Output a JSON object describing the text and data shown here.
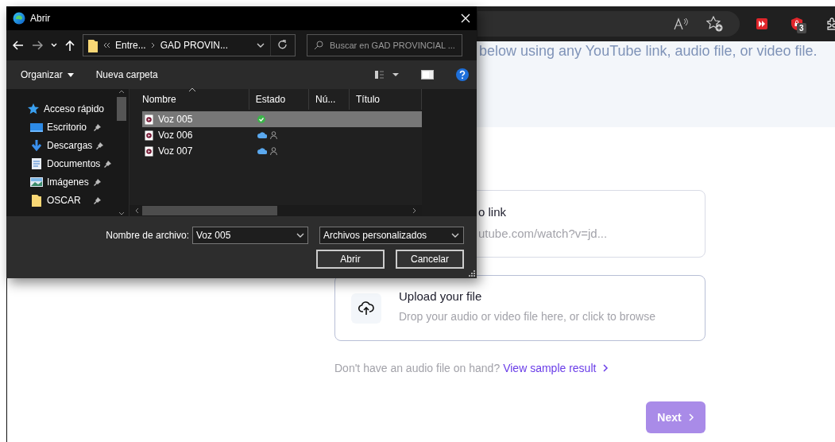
{
  "browser_toolbar": {
    "extension_badge": "3"
  },
  "dialog": {
    "title": "Abrir",
    "path": [
      "Entre...",
      "GAD PROVIN..."
    ],
    "search": {
      "placeholder": "Buscar en GAD PROVINCIAL ..."
    },
    "commands": [
      "Organizar",
      "Nueva carpeta"
    ],
    "sidebar": {
      "items": [
        {
          "label": "Acceso rápido",
          "kind": "star",
          "pinned": false
        },
        {
          "label": "Escritorio",
          "kind": "desktop",
          "pinned": true
        },
        {
          "label": "Descargas",
          "kind": "download",
          "pinned": true
        },
        {
          "label": "Documentos",
          "kind": "document",
          "pinned": true
        },
        {
          "label": "Imágenes",
          "kind": "picture",
          "pinned": true
        },
        {
          "label": "OSCAR",
          "kind": "folder",
          "pinned": true
        }
      ]
    },
    "columns": [
      "Nombre",
      "Estado",
      "Nú...",
      "Título"
    ],
    "files": [
      {
        "name": "Voz 005",
        "selected": true,
        "kind": "synced"
      },
      {
        "name": "Voz 006",
        "selected": false,
        "kind": "cloud"
      },
      {
        "name": "Voz 007",
        "selected": false,
        "kind": "cloud"
      }
    ],
    "filename_label": "Nombre de archivo:",
    "filename": "Voz 005",
    "filetype": "Archivos personalizados",
    "buttons": [
      "Abrir",
      "Cancelar"
    ]
  },
  "page": {
    "intro": "below using any YouTube link, audio file, or video file.",
    "link_card": {
      "title": "o link",
      "placeholder": "utube.com/watch?v=jd..."
    },
    "upload_card": {
      "title": "Upload your file",
      "subtitle": "Drop your audio or video file here, or click to browse"
    },
    "sample": {
      "text": "Don't have an audio file on hand?",
      "link": "View sample result"
    },
    "next_button": {
      "label": "Next",
      "disabled": true
    }
  }
}
